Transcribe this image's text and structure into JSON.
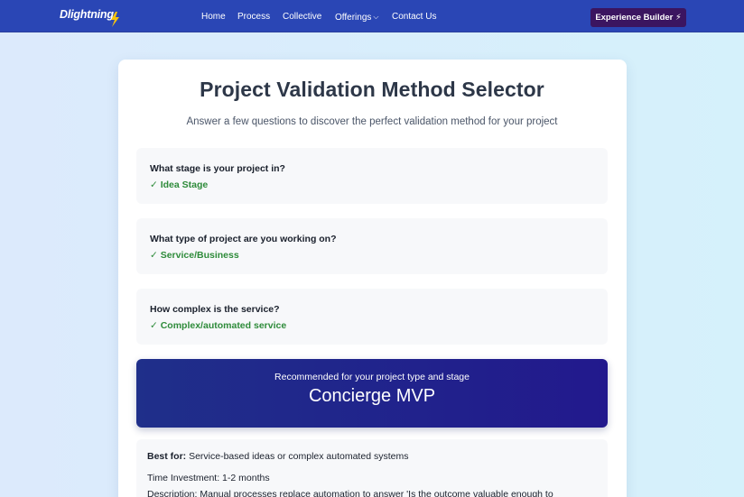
{
  "nav": {
    "logo": "Dlightning",
    "logo_icon": "lightning-bolt-icon",
    "links": [
      "Home",
      "Process",
      "Collective",
      "Offerings",
      "Contact Us"
    ],
    "cta": "Experience Builder ⚡"
  },
  "page": {
    "title": "Project Validation Method Selector",
    "subtitle": "Answer a few questions to discover the perfect validation method for your project"
  },
  "questions": [
    {
      "question": "What stage is your project in?",
      "answer": "✓ Idea Stage"
    },
    {
      "question": "What type of project are you working on?",
      "answer": "✓ Service/Business"
    },
    {
      "question": "How complex is the service?",
      "answer": "✓ Complex/automated service"
    }
  ],
  "recommendation": {
    "subtitle": "Recommended for your project type and stage",
    "method": "Concierge MVP"
  },
  "details": {
    "best_for_label": "Best for:",
    "best_for_value": " Service-based ideas or complex automated systems",
    "time_investment": "Time Investment: 1-2 months",
    "description": "Description: Manual processes replace automation to answer 'Is the outcome valuable enough to"
  },
  "colors": {
    "nav_bg": "#2a46b5",
    "cta_bg": "#3b1560",
    "answer_green": "#2e8b3a",
    "recommendation_bg": "#22198d"
  }
}
